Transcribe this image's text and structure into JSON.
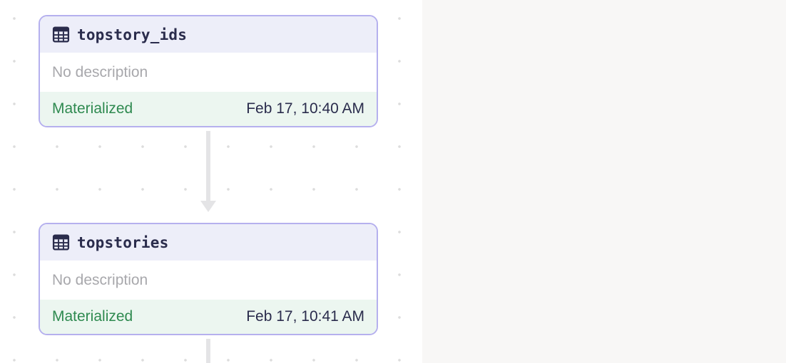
{
  "nodes": [
    {
      "title": "topstory_ids",
      "description": "No description",
      "status": "Materialized",
      "timestamp": "Feb 17, 10:40 AM"
    },
    {
      "title": "topstories",
      "description": "No description",
      "status": "Materialized",
      "timestamp": "Feb 17, 10:41 AM"
    }
  ],
  "icons": {
    "node_icon": "table-icon"
  },
  "colors": {
    "node_border": "#b5b0ee",
    "header_background": "#edeef9",
    "status_background": "#ecf6f0",
    "status_text": "#2f8a50",
    "edge": "#e4e4e6"
  }
}
